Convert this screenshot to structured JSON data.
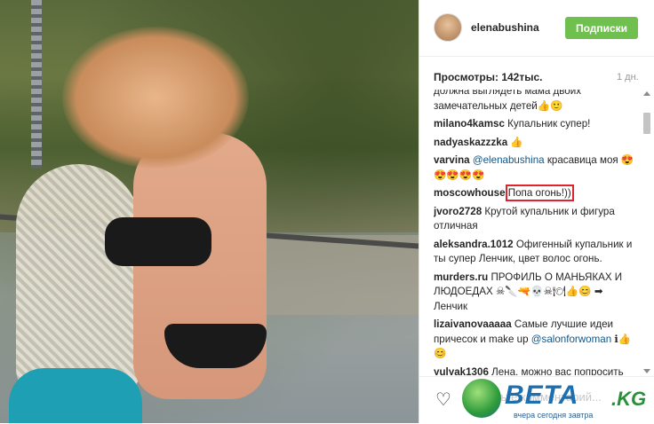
{
  "post": {
    "username": "elenabushina",
    "follow_label": "Подписки",
    "views": "Просмотры: 142тыс.",
    "age": "1 дн.",
    "add_comment_placeholder": "Добавьте комментарий..."
  },
  "comments": [
    {
      "user": "",
      "text": "должна выглядеть мама двоих замечательных детей👍🙂"
    },
    {
      "user": "milano4kamsc",
      "text": "Купальник супер!"
    },
    {
      "user": "nadyaskazzzka",
      "text": "👍"
    },
    {
      "user": "varvina",
      "mention": "@elenabushina",
      "text": " красавица моя 😍😍😍😍😍"
    },
    {
      "user": "moscowhouse",
      "text": "Попа огонь!))",
      "highlight": true
    },
    {
      "user": "jvoro2728",
      "text": "Крутой купальник и фигура отличная"
    },
    {
      "user": "aleksandra.1012",
      "text": "Офигенный купальник и ты супер Ленчик, цвет волос огонь."
    },
    {
      "user": "murders.ru",
      "text": "ПРОФИЛЬ О МАНЬЯКАХ И ЛЮДОЕДАХ ☠🔪🔫💀☠🍽👍😊 ➡ Ленчик"
    },
    {
      "user": "lizaivanovaaaaa",
      "text": "Самые лучшие идеи причесок и make up ",
      "mention_after": "@salonforwoman",
      "tail": " ℹ👍😊"
    },
    {
      "user": "yulyak1306",
      "text": "Лена, можно вас попросить больше разных фото и"
    }
  ],
  "watermark": {
    "brand": "BETA",
    "tld": ".KG",
    "tagline": "вчера сегодня завтра"
  },
  "icons": {
    "like": "heart-outline-icon"
  }
}
